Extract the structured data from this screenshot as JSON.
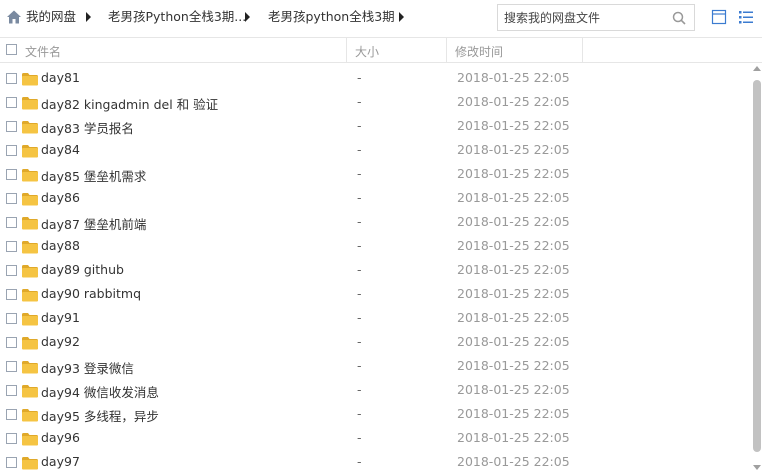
{
  "breadcrumb": {
    "items": [
      "我的网盘",
      "老男孩Python全栈3期...",
      "老男孩python全栈3期"
    ]
  },
  "search": {
    "placeholder": "搜索我的网盘文件"
  },
  "header": {
    "name": "文件名",
    "size": "大小",
    "modified": "修改时间"
  },
  "files": [
    {
      "name": "day81",
      "size": "-",
      "modified": "2018-01-25 22:05"
    },
    {
      "name": "day82 kingadmin del 和 验证",
      "size": "-",
      "modified": "2018-01-25 22:05"
    },
    {
      "name": "day83 学员报名",
      "size": "-",
      "modified": "2018-01-25 22:05"
    },
    {
      "name": "day84",
      "size": "-",
      "modified": "2018-01-25 22:05"
    },
    {
      "name": "day85 堡垒机需求",
      "size": "-",
      "modified": "2018-01-25 22:05"
    },
    {
      "name": "day86",
      "size": "-",
      "modified": "2018-01-25 22:05"
    },
    {
      "name": "day87 堡垒机前端",
      "size": "-",
      "modified": "2018-01-25 22:05"
    },
    {
      "name": "day88",
      "size": "-",
      "modified": "2018-01-25 22:05"
    },
    {
      "name": "day89 github",
      "size": "-",
      "modified": "2018-01-25 22:05"
    },
    {
      "name": "day90 rabbitmq",
      "size": "-",
      "modified": "2018-01-25 22:05"
    },
    {
      "name": "day91",
      "size": "-",
      "modified": "2018-01-25 22:05"
    },
    {
      "name": "day92",
      "size": "-",
      "modified": "2018-01-25 22:05"
    },
    {
      "name": "day93 登录微信",
      "size": "-",
      "modified": "2018-01-25 22:05"
    },
    {
      "name": "day94 微信收发消息",
      "size": "-",
      "modified": "2018-01-25 22:05"
    },
    {
      "name": "day95  多线程，异步",
      "size": "-",
      "modified": "2018-01-25 22:05"
    },
    {
      "name": "day96",
      "size": "-",
      "modified": "2018-01-25 22:05"
    },
    {
      "name": "day97",
      "size": "-",
      "modified": "2018-01-25 22:05"
    }
  ],
  "icons": {
    "home": "home-icon",
    "folder": "folder-icon",
    "search": "search-icon",
    "grid_view": "grid-view-icon",
    "list_view": "list-view-icon"
  },
  "colors": {
    "folder": "#f5c443",
    "folder_dark": "#e0a92a",
    "icon_blue": "#3b7bd0"
  }
}
